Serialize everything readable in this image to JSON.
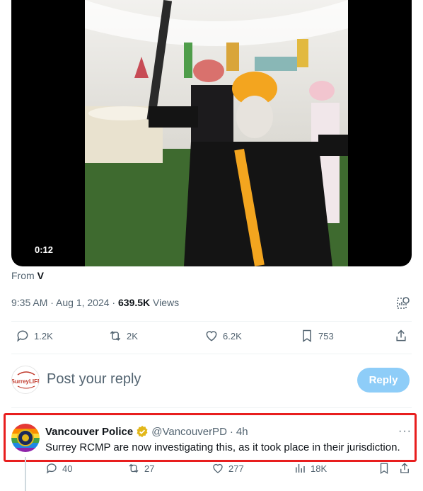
{
  "video": {
    "duration": "0:12"
  },
  "source": {
    "prefix": "From ",
    "name": "V"
  },
  "meta": {
    "timestamp": "9:35 AM · Aug 1, 2024 · ",
    "views_count": "639.5K",
    "views_label": " Views",
    "icon": "analytics-icon"
  },
  "actions": {
    "replies": "1.2K",
    "reposts": "2K",
    "likes": "6.2K",
    "bookmarks": "753"
  },
  "composer": {
    "placeholder": "Post your reply",
    "button": "Reply",
    "avatar_text": "SurreyLIFE"
  },
  "reply": {
    "name": "Vancouver Police",
    "handle": "@VancouverPD",
    "dot": "·",
    "time": "4h",
    "more": "···",
    "text": "Surrey RCMP are now investigating this, as it took place in their jurisdiction.",
    "stats": {
      "replies": "40",
      "reposts": "27",
      "likes": "277",
      "views": "18K"
    }
  },
  "colors": {
    "highlight": "#e81e1e",
    "verified": "#e2b719",
    "reply_button": "#8ecdf8",
    "muted": "#536471"
  }
}
